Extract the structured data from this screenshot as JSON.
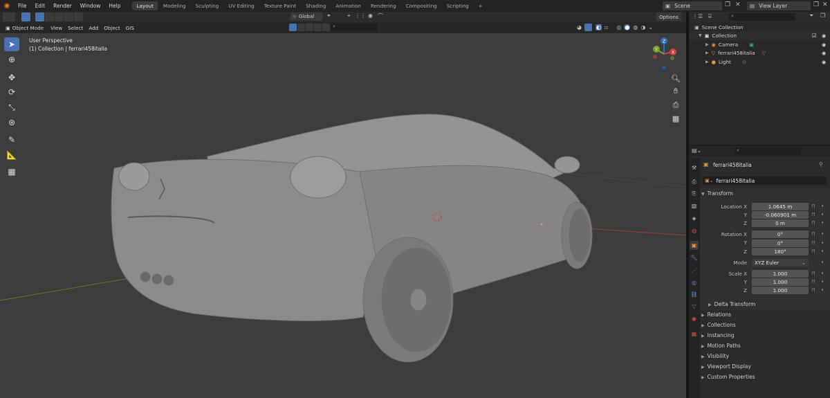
{
  "menu": {
    "items": [
      "File",
      "Edit",
      "Render",
      "Window",
      "Help"
    ]
  },
  "workspaces": {
    "tabs": [
      "Layout",
      "Modeling",
      "Sculpting",
      "UV Editing",
      "Texture Paint",
      "Shading",
      "Animation",
      "Rendering",
      "Compositing",
      "Scripting"
    ],
    "active": "Layout",
    "add_symbol": "+"
  },
  "scene": {
    "name": "Scene",
    "view_layer": "View Layer"
  },
  "tool_header": {
    "orientation": "Global",
    "options_label": "Options"
  },
  "viewport_header": {
    "mode": "Object Mode",
    "menus": [
      "View",
      "Select",
      "Add",
      "Object",
      "GIS"
    ]
  },
  "viewport": {
    "perspective": "User Perspective",
    "collection_info": "(1) Collection | ferrari458italia",
    "gizmo": {
      "x": "X",
      "y": "Y",
      "z": "Z"
    }
  },
  "outliner": {
    "root": "Scene Collection",
    "collection": "Collection",
    "items": [
      "Camera",
      "ferrari458italia",
      "Light"
    ]
  },
  "properties": {
    "object_name": "ferrari458italia",
    "data_name": "ferrari458italia",
    "transform_header": "Transform",
    "location": {
      "label": "Location X",
      "x": "1.0645 m",
      "y": "-0.060901 m",
      "z": "0 m"
    },
    "rotation": {
      "label": "Rotation X",
      "x": "0°",
      "y": "0°",
      "z": "180°"
    },
    "mode": {
      "label": "Mode",
      "value": "XYZ Euler"
    },
    "scale": {
      "label": "Scale X",
      "x": "1.000",
      "y": "1.000",
      "z": "1.000"
    },
    "axis_y": "Y",
    "axis_z": "Z",
    "delta": "Delta Transform",
    "panels": [
      "Relations",
      "Collections",
      "Instancing",
      "Motion Paths",
      "Visibility",
      "Viewport Display",
      "Custom Properties"
    ]
  },
  "colors": {
    "accent": "#4772b3",
    "viewport_bg": "#3d3d3d",
    "axis_red": "#b5403c",
    "axis_green": "#6b8a2a",
    "car": "#8c8c8c"
  }
}
